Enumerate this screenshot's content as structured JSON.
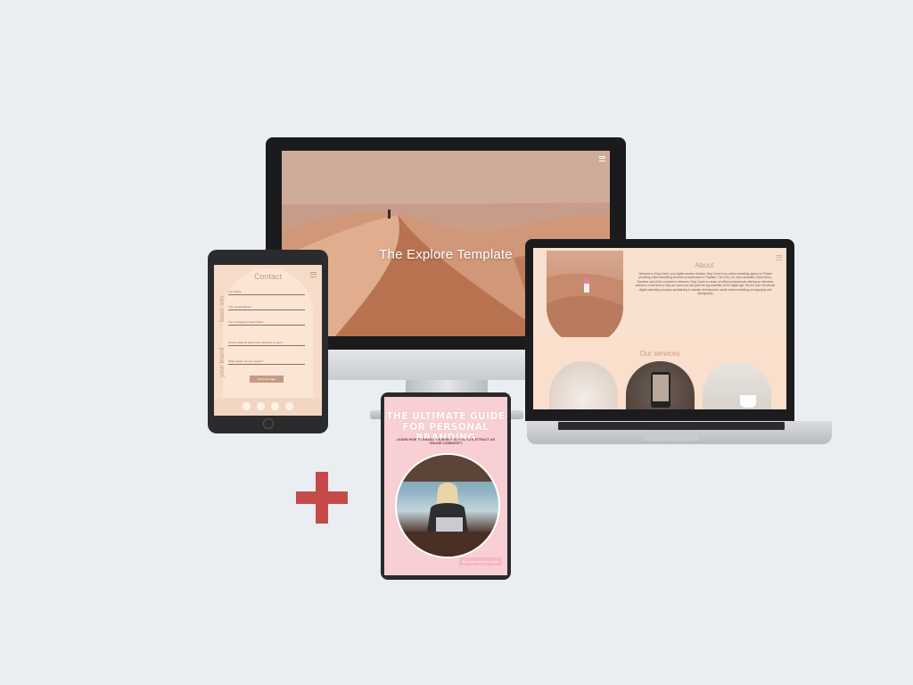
{
  "monitor": {
    "title": "The Explore Template"
  },
  "tablet": {
    "heading": "Contact",
    "side_label_top": "basic info",
    "side_label_bottom": "your brand",
    "fields": [
      {
        "label": "Your Name"
      },
      {
        "label": "Your email Address"
      },
      {
        "label": "Your Company's Guest Name"
      },
      {
        "label": "Tell us a little bit about your business or event"
      },
      {
        "label": "What service do you require?"
      }
    ],
    "submit_label": "Send Message"
  },
  "laptop": {
    "about_title": "About",
    "about_text": "Welcome to King Creek, your digital creative solution. King Creek is an online marketing agency in Phuket providing online marketing services to businesses in Thailand, The USA, UK, Asia, Australia, South Africa, Zanzibar and all the countries in between. King Creek is a team of skilled professionals offering an extensive selection of services to help you stand out and grab the opportunities of the digital age. We are your full service digital marketing company specializing in website development, social media marketing, photography and videography.",
    "services_title": "Our services"
  },
  "ebook": {
    "title_line1": "THE ULTIMATE GUIDE",
    "title_line2": "FOR PERSONAL BRANDING",
    "subtitle": "LEARN HOW TO BRAND YOURSELF SO YOU CAN ATTRACT AN ONLINE COMMUNITY",
    "tag": "By Linda and the Crew"
  },
  "colors": {
    "background": "#eaeef2",
    "plus": "#c64a4a",
    "ebook_pink": "#f8cfd3",
    "peach": "#f8e1d0",
    "accent_text": "#c59b86"
  }
}
